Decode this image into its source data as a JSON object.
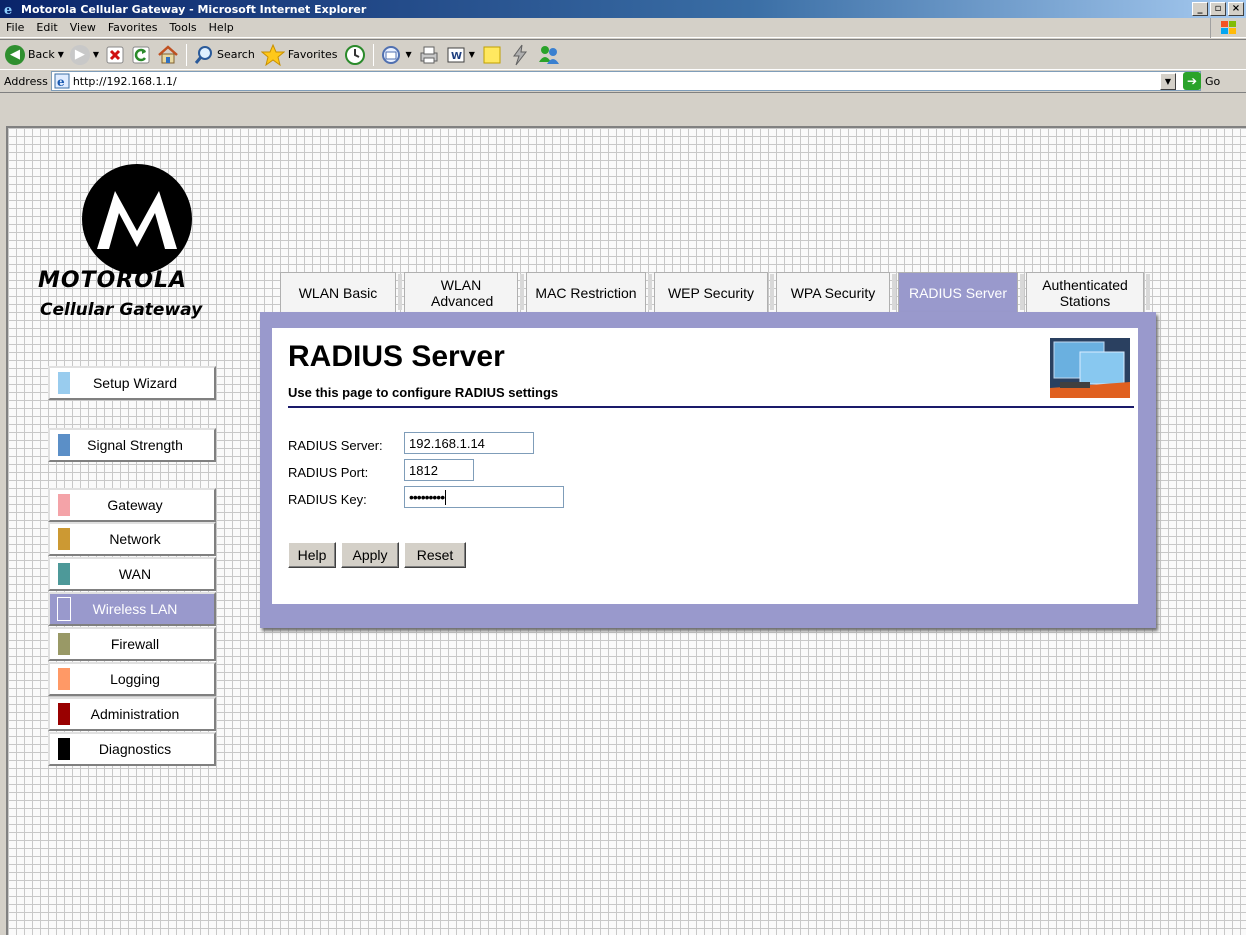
{
  "window": {
    "title": "Motorola Cellular Gateway - Microsoft Internet Explorer",
    "controls": [
      "_",
      "▫",
      "×"
    ]
  },
  "menu": [
    "File",
    "Edit",
    "View",
    "Favorites",
    "Tools",
    "Help"
  ],
  "toolbar": {
    "back_label": "Back",
    "search_label": "Search",
    "favorites_label": "Favorites"
  },
  "address": {
    "label": "Address",
    "url": "http://192.168.1.1/",
    "go_label": "Go"
  },
  "brand": {
    "name": "MOTOROLA",
    "product": "Cellular Gateway"
  },
  "nav": {
    "items": [
      {
        "label": "Setup Wizard",
        "color": "#99ccee"
      },
      {
        "label": "Signal Strength",
        "color": "#5b8fc7"
      },
      {
        "label": "Gateway",
        "color": "#f4a3a8"
      },
      {
        "label": "Network",
        "color": "#cc9933"
      },
      {
        "label": "WAN",
        "color": "#4d9999"
      },
      {
        "label": "Wireless LAN",
        "color": "#9999cc",
        "active": true
      },
      {
        "label": "Firewall",
        "color": "#999966"
      },
      {
        "label": "Logging",
        "color": "#ff9966"
      },
      {
        "label": "Administration",
        "color": "#990000"
      },
      {
        "label": "Diagnostics",
        "color": "#000000"
      }
    ]
  },
  "tabs": [
    {
      "label": "WLAN Basic"
    },
    {
      "label": "WLAN Advanced"
    },
    {
      "label": "MAC Restriction"
    },
    {
      "label": "WEP Security"
    },
    {
      "label": "WPA Security"
    },
    {
      "label": "RADIUS Server",
      "active": true
    },
    {
      "label": "Authenticated Stations"
    }
  ],
  "page": {
    "title": "RADIUS Server",
    "subtitle": "Use this page to configure RADIUS settings"
  },
  "form": {
    "server_label": "RADIUS Server:",
    "server_value": "192.168.1.14",
    "port_label": "RADIUS Port:",
    "port_value": "1812",
    "key_label": "RADIUS Key:",
    "key_value": "•••••••••"
  },
  "buttons": {
    "help": "Help",
    "apply": "Apply",
    "reset": "Reset"
  }
}
